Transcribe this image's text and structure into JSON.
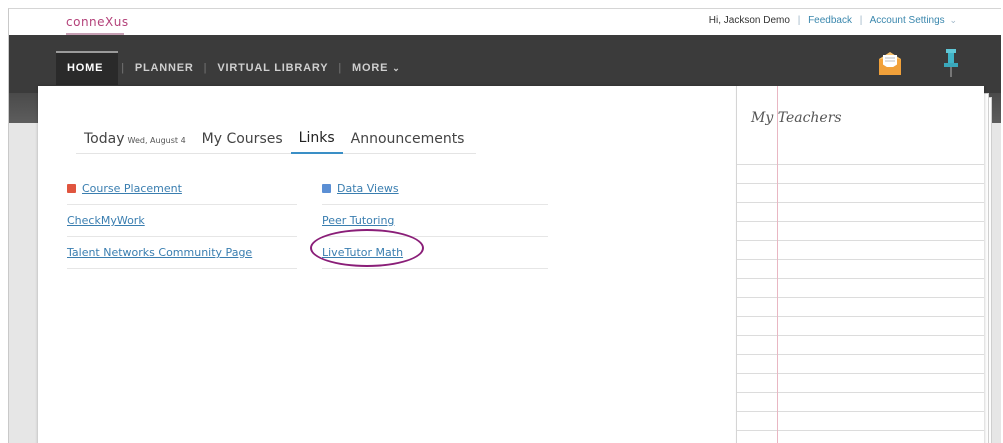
{
  "header": {
    "logo_text": "conneXus",
    "greeting": "Hi, Jackson Demo",
    "feedback": "Feedback",
    "account_settings": "Account Settings"
  },
  "nav": {
    "items": [
      {
        "label": "HOME"
      },
      {
        "label": "PLANNER"
      },
      {
        "label": "VIRTUAL LIBRARY"
      },
      {
        "label": "MORE"
      }
    ],
    "icons": [
      "mail-icon",
      "pin-icon"
    ]
  },
  "tabs": {
    "today": "Today",
    "today_date": "Wed, August 4",
    "my_courses": "My Courses",
    "links": "Links",
    "announcements": "Announcements",
    "active": "Links"
  },
  "links": {
    "left": [
      {
        "label": "Course Placement",
        "icon": "book-icon"
      },
      {
        "label": "CheckMyWork"
      },
      {
        "label": "Talent Networks Community Page"
      }
    ],
    "right": [
      {
        "label": "Data Views",
        "icon": "data-icon"
      },
      {
        "label": "Peer Tutoring"
      },
      {
        "label": "LiveTutor Math"
      }
    ]
  },
  "notepad": {
    "title": "My Teachers"
  },
  "colors": {
    "accent": "#3a8fc6",
    "link": "#3a7eb0",
    "nav_bg": "#3b3b3b",
    "highlight_circle": "#8a1e78",
    "logo": "#b4427a"
  }
}
